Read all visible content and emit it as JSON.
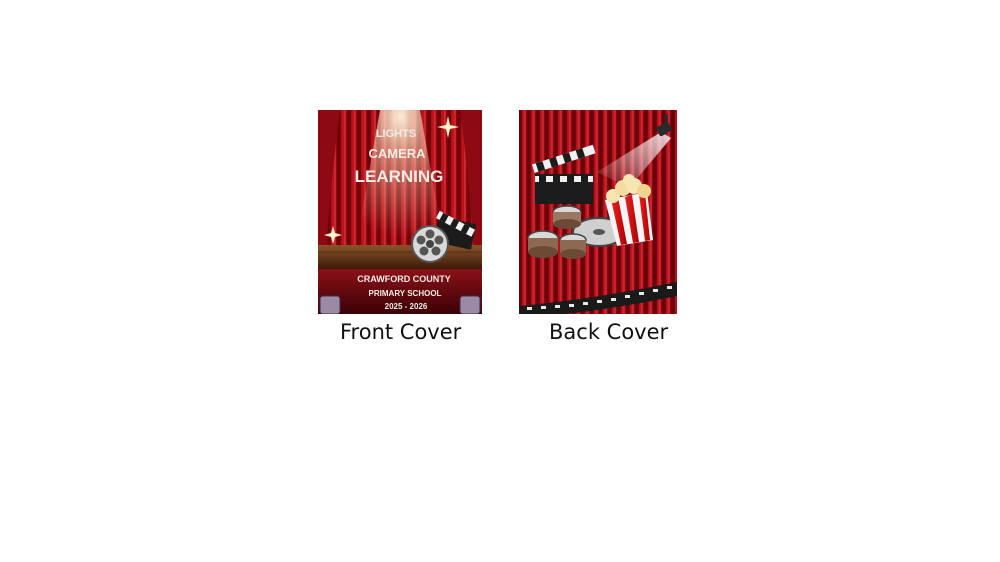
{
  "front_cover": {
    "headline": [
      "LIGHTS",
      "CAMERA",
      "LEARNING"
    ],
    "school_line1": "CRAWFORD COUNTY",
    "school_line2": "PRIMARY SCHOOL",
    "years": "2025 - 2026",
    "caption": "Front Cover"
  },
  "back_cover": {
    "caption": "Back Cover"
  },
  "colors": {
    "curtain_dark": "#5a0006",
    "curtain_mid": "#b3101a",
    "curtain_light": "#e0313a",
    "stage_floor": "#6b3a1e",
    "spotlight": "#fff6d8"
  },
  "icons": [
    "clapperboard-icon",
    "film-reel-icon",
    "popcorn-icon",
    "spotlight-icon",
    "film-strip-icon",
    "sparkle-icon"
  ]
}
